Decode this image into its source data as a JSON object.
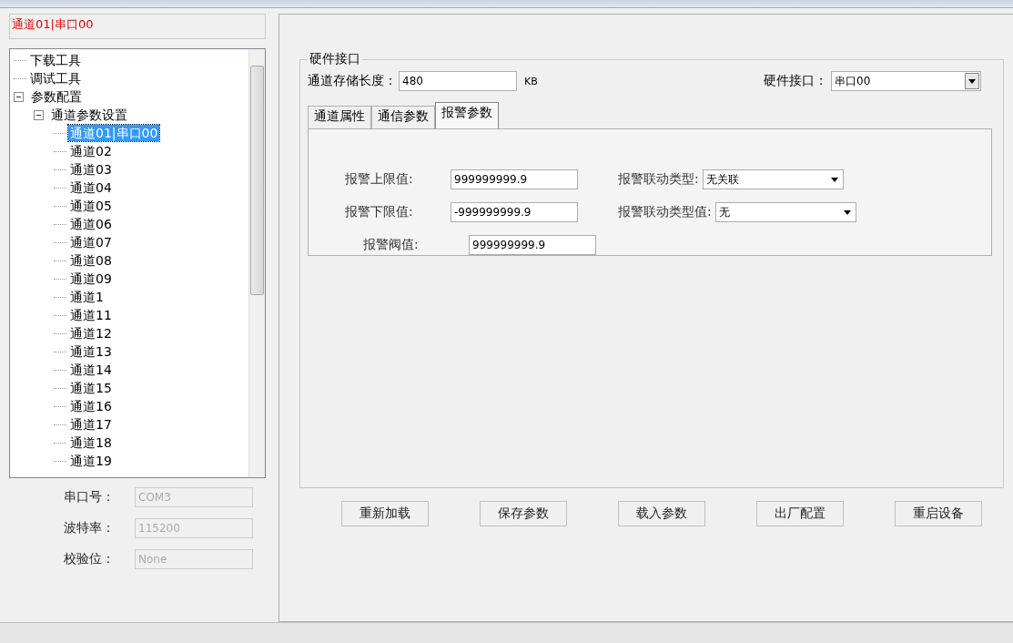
{
  "channel_label": "通道01|串口00",
  "tree": [
    {
      "label": "下载工具",
      "selected": false
    },
    {
      "label": "调试工具",
      "selected": false
    },
    {
      "label": "参数配置",
      "selected": false,
      "expanded": true,
      "children": [
        {
          "label": "通道参数设置",
          "selected": false,
          "expanded": true,
          "children": [
            {
              "label": "通道01|串口00",
              "selected": true
            },
            {
              "label": "通道02",
              "selected": false
            },
            {
              "label": "通道03",
              "selected": false
            },
            {
              "label": "通道04",
              "selected": false
            },
            {
              "label": "通道05",
              "selected": false
            },
            {
              "label": "通道06",
              "selected": false
            },
            {
              "label": "通道07",
              "selected": false
            },
            {
              "label": "通道08",
              "selected": false
            },
            {
              "label": "通道09",
              "selected": false
            },
            {
              "label": "通道1",
              "selected": false
            },
            {
              "label": "通道11",
              "selected": false
            },
            {
              "label": "通道12",
              "selected": false
            },
            {
              "label": "通道13",
              "selected": false
            },
            {
              "label": "通道14",
              "selected": false
            },
            {
              "label": "通道15",
              "selected": false
            },
            {
              "label": "通道16",
              "selected": false
            },
            {
              "label": "通道17",
              "selected": false
            },
            {
              "label": "通道18",
              "selected": false
            },
            {
              "label": "通道19",
              "selected": false
            }
          ]
        }
      ]
    }
  ],
  "serial": [
    {
      "label": "串口号：",
      "value": "COM3",
      "disabled": true
    },
    {
      "label": "波特率：",
      "value": "115200",
      "disabled": true
    },
    {
      "label": "校验位：",
      "value": "None",
      "disabled": true
    }
  ],
  "group": {
    "title": "硬件接口",
    "storage_label": "通道存储长度：",
    "storage_value": "480",
    "storage_unit": "KB",
    "interface_label": "硬件接口：",
    "interface_value": "串口00"
  },
  "tabs": [
    {
      "label": "通道属性",
      "selected": false
    },
    {
      "label": "通信参数",
      "selected": false
    },
    {
      "label": "报警参数",
      "selected": true
    }
  ],
  "alarm_fields": [
    {
      "label": "报警上限值:",
      "value": "999999999.9",
      "kind": "text"
    },
    {
      "label": "报警联动类型:",
      "value": "无关联",
      "kind": "select"
    },
    {
      "label": "报警下限值:",
      "value": "-999999999.9",
      "kind": "text"
    },
    {
      "label": "报警联动类型值:",
      "value": "无",
      "kind": "select"
    },
    {
      "label": "报警阀值:",
      "value": "999999999.9",
      "kind": "text"
    }
  ],
  "buttons": [
    "重新加载",
    "保存参数",
    "载入参数",
    "出厂配置",
    "重启设备"
  ]
}
